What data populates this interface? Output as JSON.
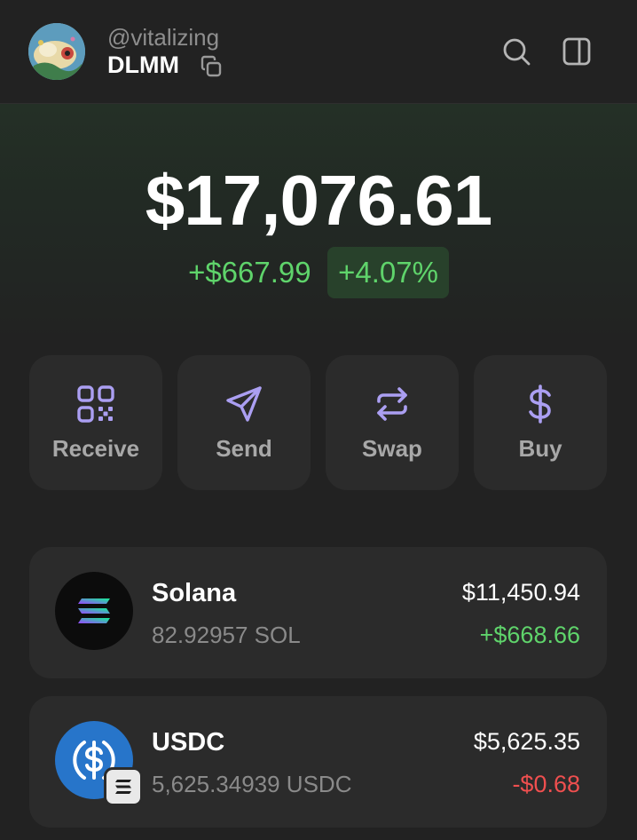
{
  "header": {
    "handle": "@vitalizing",
    "account_name": "DLMM"
  },
  "balance": {
    "total": "$17,076.61",
    "change_amount": "+$667.99",
    "change_percent": "+4.07%"
  },
  "actions": [
    {
      "label": "Receive",
      "icon": "qr-code-icon"
    },
    {
      "label": "Send",
      "icon": "send-icon"
    },
    {
      "label": "Swap",
      "icon": "swap-icon"
    },
    {
      "label": "Buy",
      "icon": "dollar-icon"
    }
  ],
  "tokens": [
    {
      "name": "Solana",
      "amount": "82.92957 SOL",
      "value": "$11,450.94",
      "change": "+$668.66",
      "change_color": "#5fd46b",
      "icon": "solana-logo-icon"
    },
    {
      "name": "USDC",
      "amount": "5,625.34939 USDC",
      "value": "$5,625.35",
      "change": "-$0.68",
      "change_color": "#ef4f4f",
      "icon": "usdc-logo-icon"
    }
  ],
  "colors": {
    "accent": "#ab9ff2",
    "positive": "#5fd46b",
    "negative": "#ef4f4f",
    "background": "#222222",
    "card": "#2b2b2b"
  }
}
